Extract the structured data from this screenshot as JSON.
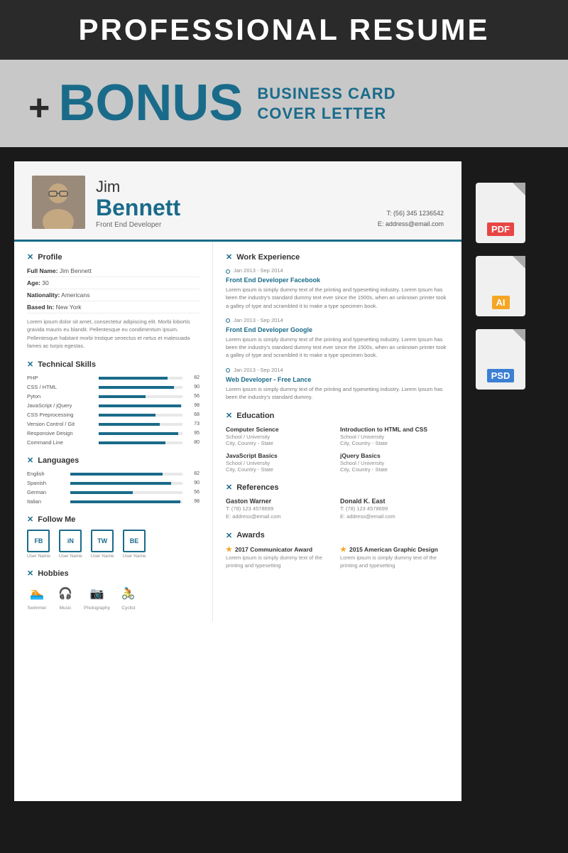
{
  "header": {
    "title": "PROFESSIONAL RESUME"
  },
  "bonus": {
    "prefix": "+",
    "word": "BONUS",
    "label1": "BUSINESS CARD",
    "label2": "COVER LETTER"
  },
  "resume": {
    "person": {
      "first_name": "Jim",
      "last_name": "Bennett",
      "job_title": "Front End Developer",
      "phone": "T: (56) 345 1236542",
      "email": "E: address@email.com"
    },
    "profile": {
      "section_title": "Profile",
      "fields": [
        {
          "label": "Full Name:",
          "value": "Jim Bennett"
        },
        {
          "label": "Age:",
          "value": "30"
        },
        {
          "label": "Nationality:",
          "value": "Americans"
        },
        {
          "label": "Based In:",
          "value": "New York"
        }
      ],
      "bio": "Lorem ipsum dolor sit amet, consectetur adipiscing elit. Morbi lobortis gravida mauris eu blandit. Pellentesque eu condimentum ipsum. Pellentesque habitant morbi tristique senectus et netus et malesuada fames ac turpis egestas."
    },
    "skills": {
      "section_title": "Technical Skills",
      "items": [
        {
          "name": "PHP",
          "value": 82
        },
        {
          "name": "CSS / HTML",
          "value": 90
        },
        {
          "name": "Pyton",
          "value": 56
        },
        {
          "name": "JavaScript / jQuery",
          "value": 98
        },
        {
          "name": "CSS Preprocessing",
          "value": 68
        },
        {
          "name": "Version Control / Git",
          "value": 73
        },
        {
          "name": "Responsive Design",
          "value": 95
        },
        {
          "name": "Command Line",
          "value": 80
        }
      ]
    },
    "languages": {
      "section_title": "Languages",
      "items": [
        {
          "name": "English",
          "value": 82
        },
        {
          "name": "Spanish",
          "value": 90
        },
        {
          "name": "German",
          "value": 56
        },
        {
          "name": "Italian",
          "value": 98
        }
      ]
    },
    "follow": {
      "section_title": "Follow Me",
      "items": [
        {
          "icon": "FB",
          "label": "User Name"
        },
        {
          "icon": "iN",
          "label": "User Name"
        },
        {
          "icon": "TW",
          "label": "User Name"
        },
        {
          "icon": "BE",
          "label": "User Name"
        }
      ]
    },
    "hobbies": {
      "section_title": "Hobbies",
      "items": [
        {
          "icon": "🏊",
          "label": "Swimmer"
        },
        {
          "icon": "🎧",
          "label": "Music"
        },
        {
          "icon": "📷",
          "label": "Photography"
        },
        {
          "icon": "🚴",
          "label": "Cyclist"
        }
      ]
    },
    "work": {
      "section_title": "Work Experience",
      "items": [
        {
          "date": "Jan 2013 - Sep 2014",
          "title": "Front End Developer Facebook",
          "desc": "Lorem ipsum is simply dummy text of the printing and typesetting industry. Lorem Ipsum has been the industry's standard dummy text ever since the 1500s, when an unknown printer took a galley of type and scrambled it to make a type specimen book."
        },
        {
          "date": "Jan 2013 - Sep 2014",
          "title": "Front End Developer Google",
          "desc": "Lorem ipsum is simply dummy text of the printing and typesetting industry. Lorem Ipsum has been the industry's standard dummy text ever since the 1500s, when an unknown printer took a galley of type and scrambled it to make a type specimen book."
        },
        {
          "date": "Jan 2013 - Sep 2014",
          "title": "Web Developer - Free Lance",
          "desc": "Lorem ipsum is simply dummy text of the printing and typesetting industry. Lorem Ipsum has been the industry's standard dummy."
        }
      ]
    },
    "education": {
      "section_title": "Education",
      "items": [
        {
          "degree": "Computer Science",
          "school": "School / University",
          "location": "City, Country - State"
        },
        {
          "degree": "Introduction to HTML and CSS",
          "school": "School / University",
          "location": "City, Country - State"
        },
        {
          "degree": "JavaScript Basics",
          "school": "School / University",
          "location": "City, Country - State"
        },
        {
          "degree": "jQuery Basics",
          "school": "School / University",
          "location": "City, Country - State"
        }
      ]
    },
    "references": {
      "section_title": "References",
      "items": [
        {
          "name": "Gaston Warner",
          "phone": "T: (78) 123 4578699",
          "email": "E: address@email.com"
        },
        {
          "name": "Donald K. East",
          "phone": "T: (78) 123 4578699",
          "email": "E: address@email.com"
        }
      ]
    },
    "awards": {
      "section_title": "Awards",
      "items": [
        {
          "title": "2017 Communicator Award",
          "desc": "Lorem ipsum is simply dummy text of the printing and typesetting"
        },
        {
          "title": "2015 American Graphic Design",
          "desc": "Lorem ipsum is simply dummy text of the printing and typesetting"
        }
      ]
    }
  },
  "file_types": [
    {
      "label": "PDF",
      "type": "pdf"
    },
    {
      "label": "AI",
      "type": "ai"
    },
    {
      "label": "PSD",
      "type": "psd"
    }
  ]
}
